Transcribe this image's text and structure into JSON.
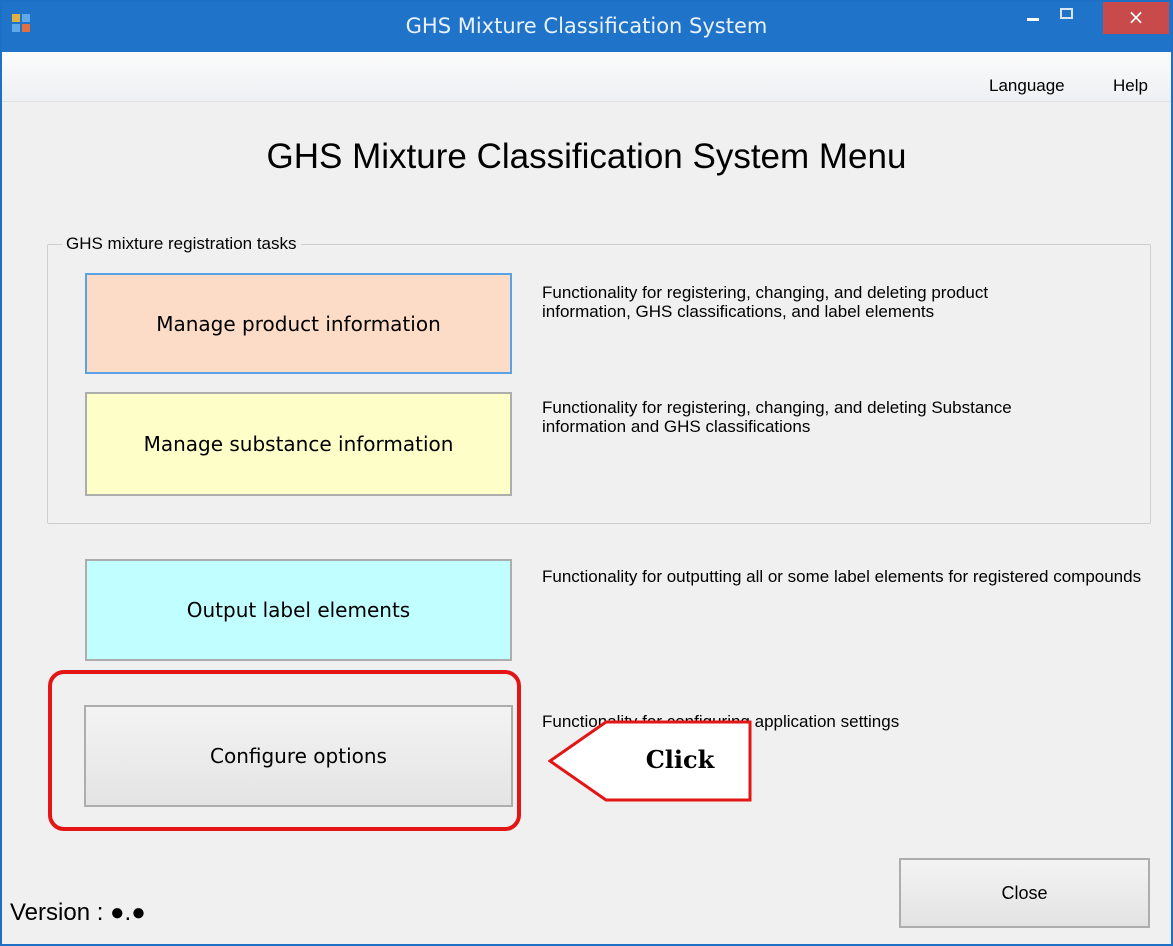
{
  "window": {
    "title": "GHS Mixture Classification System",
    "close_glyph": "×"
  },
  "menubar": {
    "language": "Language",
    "help": "Help"
  },
  "main": {
    "heading": "GHS Mixture Classification System Menu",
    "group_label": "GHS mixture registration tasks",
    "buttons": {
      "product": "Manage product information",
      "substance": "Manage substance information",
      "output": "Output label elements",
      "config": "Configure options",
      "close": "Close"
    },
    "descriptions": {
      "product": "Functionality for registering, changing, and deleting product information, GHS classifications, and label elements",
      "substance": "Functionality for registering, changing, and deleting Substance information and GHS classifications",
      "output": "Functionality for outputting all or some label elements for registered compounds",
      "config": "Functionality for configuring application settings"
    }
  },
  "annotation": {
    "callout": "Click"
  },
  "footer": {
    "version": "Version : ●.●"
  },
  "colors": {
    "titlebar": "#1f73c9",
    "product_bg": "#fcdcc6",
    "substance_bg": "#fefec9",
    "output_bg": "#c1feff",
    "highlight": "#e41515"
  }
}
